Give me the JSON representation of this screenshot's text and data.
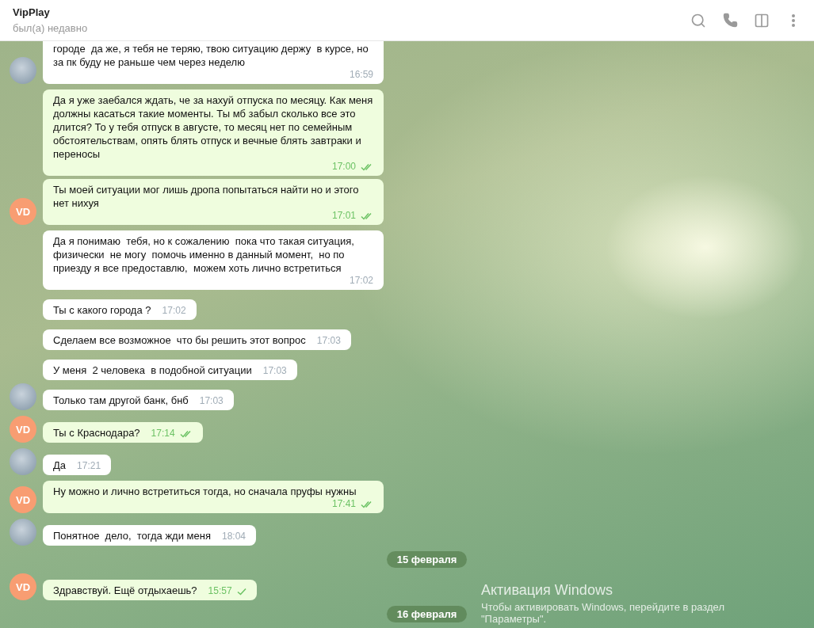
{
  "header": {
    "title": "VipPlay",
    "status": "был(а) недавно"
  },
  "messages": [
    {
      "kind": "incoming",
      "text": "городе  да же, я тебя не теряю, твою ситуацию держу  в курсе, но за пк буду не раньше чем через неделю",
      "time": "16:59",
      "avatar": {
        "kind": "photo"
      }
    },
    {
      "kind": "outgoing",
      "text": "Да я уже заебался ждать, че за нахуй отпуска по месяцу. Как меня должны касаться такие моменты. Ты мб забыл сколько все это длится? То у тебя отпуск в августе, то месяц нет по семейным обстоятельствам, опять блять отпуск и вечные блять завтраки и переносы",
      "time": "17:00",
      "read": true
    },
    {
      "kind": "outgoing",
      "text": "Ты моей ситуации мог лишь дропа попытаться найти но и этого нет нихуя",
      "time": "17:01",
      "read": true,
      "avatar": {
        "kind": "initials",
        "text": "VD"
      }
    },
    {
      "kind": "incoming",
      "text": "Да я понимаю  тебя, но к сожалению  пока что такая ситуация, физически  не могу  помочь именно в данный момент,  но по приезду я все предоставлю,  можем хоть лично встретиться",
      "time": "17:02"
    },
    {
      "kind": "incoming",
      "text": "Ты с какого города ?",
      "time": "17:02"
    },
    {
      "kind": "incoming",
      "text": "Сделаем все возможное  что бы решить этот вопрос",
      "time": "17:03"
    },
    {
      "kind": "incoming",
      "text": "У меня  2 человека  в подобной ситуации",
      "time": "17:03"
    },
    {
      "kind": "incoming",
      "text": "Только там другой банк, бнб",
      "time": "17:03",
      "avatar": {
        "kind": "photo"
      }
    },
    {
      "kind": "outgoing",
      "text": "Ты с Краснодара?",
      "time": "17:14",
      "read": true,
      "avatar": {
        "kind": "initials",
        "text": "VD"
      }
    },
    {
      "kind": "incoming",
      "text": "Да",
      "time": "17:21",
      "avatar": {
        "kind": "photo"
      }
    },
    {
      "kind": "outgoing",
      "text": "Ну можно и лично встретиться тогда, но сначала пруфы нужны",
      "time": "17:41",
      "read": true,
      "avatar": {
        "kind": "initials",
        "text": "VD"
      }
    },
    {
      "kind": "incoming",
      "text": "Понятное  дело,  тогда жди меня",
      "time": "18:04",
      "avatar": {
        "kind": "photo"
      }
    },
    {
      "kind": "date",
      "text": "15 февраля"
    },
    {
      "kind": "outgoing",
      "text": "Здравствуй. Ещё отдыхаешь?",
      "time": "15:57",
      "read": false,
      "avatar": {
        "kind": "initials",
        "text": "VD"
      }
    },
    {
      "kind": "date",
      "text": "16 февраля"
    }
  ],
  "activation_notice": {
    "title": "Активация Windows",
    "text": "Чтобы активировать Windows, перейдите в раздел \"Параметры\"."
  }
}
